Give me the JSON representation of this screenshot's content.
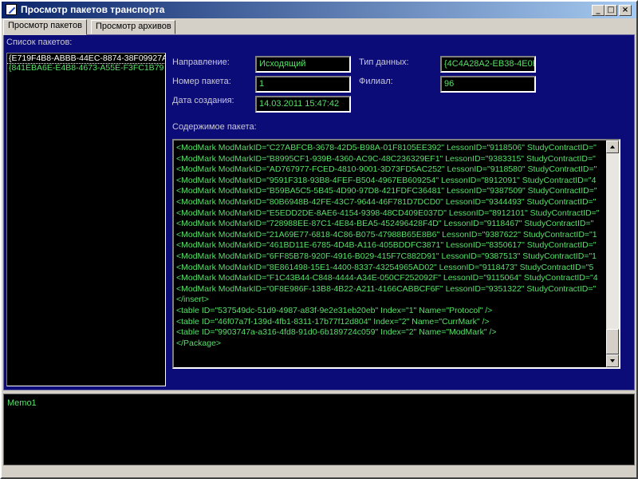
{
  "window": {
    "title": "Просмотр пакетов транспорта",
    "controls": {
      "minimize": "_",
      "maximize": "□",
      "close": "×"
    }
  },
  "tabs": [
    {
      "label": "Просмотр пакетов",
      "active": true
    },
    {
      "label": "Просмотр архивов",
      "active": false
    }
  ],
  "packet_list": {
    "label": "Список пакетов:",
    "items": [
      {
        "text": "{E719F4B8-ABBB-44EC-8874-38F09927A",
        "selected": true
      },
      {
        "text": "{841EBA6E-E4B8-4673-A55E-F3FC1B79",
        "selected": false
      }
    ]
  },
  "details": {
    "direction_label": "Направление:",
    "direction_value": "Исходящий",
    "number_label": "Номер пакета:",
    "number_value": "1",
    "created_label": "Дата создания:",
    "created_value": "14.03.2011 15:47:42",
    "datatype_label": "Тип данных:",
    "datatype_value": "{4C4A28A2-EB38-4E0B",
    "branch_label": "Филиал:",
    "branch_value": "96"
  },
  "content": {
    "label": "Содержимое пакета:",
    "lines": [
      "<ModMark ModMarkID=\"C27ABFCB-3678-42D5-B98A-01F8105EE392\" LessonID=\"9118506\" StudyContractID=\"",
      "<ModMark ModMarkID=\"B8995CF1-939B-4360-AC9C-48C236329EF1\" LessonID=\"9383315\" StudyContractID=\"",
      "<ModMark ModMarkID=\"AD767977-FCED-4810-9001-3D73FD5AC252\" LessonID=\"9118580\" StudyContractID=\"",
      "<ModMark ModMarkID=\"9591F318-93B8-4FEF-B504-4967EB609254\" LessonID=\"8912091\" StudyContractID=\"4",
      "<ModMark ModMarkID=\"B59BA5C5-5B45-4D90-97D8-421FDFC36481\" LessonID=\"9387509\" StudyContractID=\"",
      "<ModMark ModMarkID=\"80B6948B-42FE-43C7-9644-46F781D7DCD0\" LessonID=\"9344493\" StudyContractID=\"",
      "<ModMark ModMarkID=\"E5EDD2DE-8AE6-4154-9398-48CD409E037D\" LessonID=\"8912101\" StudyContractID=\"",
      "<ModMark ModMarkID=\"728988EE-87C1-4E84-BEA5-452496428F4D\" LessonID=\"9118467\" StudyContractID=\"",
      "<ModMark ModMarkID=\"21A69E77-6818-4C86-B075-47988B65E8B6\" LessonID=\"9387622\" StudyContractID=\"1",
      "<ModMark ModMarkID=\"461BD11E-6785-4D4B-A116-405BDDFC3871\" LessonID=\"8350617\" StudyContractID=\"",
      "<ModMark ModMarkID=\"6FF85B78-920F-4916-B029-415F7C882D91\" LessonID=\"9387513\" StudyContractID=\"1",
      "<ModMark ModMarkID=\"8E861498-15E1-4400-8337-43254965AD02\" LessonID=\"9118473\" StudyContractID=\"5",
      "<ModMark ModMarkID=\"F1C43B44-C848-4444-A34E-050CF252092F\" LessonID=\"9115064\" StudyContractID=\"4",
      "<ModMark ModMarkID=\"0F8E986F-13B8-4B22-A211-4166CABBCF6F\" LessonID=\"9351322\" StudyContractID=\"",
      "</insert>",
      "<table ID=\"537549dc-51d9-4987-a83f-9e2e31eb20eb\" Index=\"1\" Name=\"Protocol\" />",
      "<table ID=\"46f07a7f-139d-4fb1-8311-17b77f12d804\" Index=\"2\" Name=\"CurrMark\" />",
      "<table ID=\"9903747a-a316-4fd8-91d0-6b189724c059\" Index=\"2\" Name=\"ModMark\" />",
      "</Package>"
    ]
  },
  "memo": {
    "text": "Memo1"
  },
  "colors": {
    "title_gradient_start": "#0a246a",
    "page_background": "#0c0c78",
    "text_green": "#56e068",
    "field_background": "#000000"
  }
}
